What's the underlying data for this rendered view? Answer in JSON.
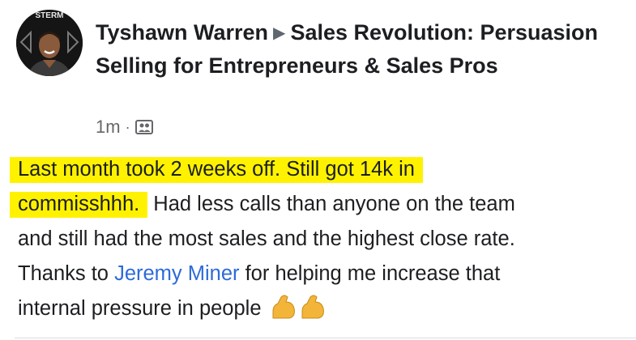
{
  "post": {
    "author": "Tyshawn Warren",
    "group": "Sales Revolution: Persuasion Selling for Entrepreneurs & Sales Pros",
    "timestamp": "1m",
    "separator": "·",
    "audience_icon": "group-audience-icon",
    "avatar_text": "STERM"
  },
  "content": {
    "highlight_line1": "Last month took 2 weeks off. Still got 14k in",
    "highlight_line2": "commisshhh.",
    "line2_rest": " Had less calls than anyone on the team",
    "line3": "and still had the most sales and the highest close rate.",
    "line4_before": "Thanks to ",
    "mention": "Jeremy Miner",
    "line4_after": " for helping me increase that",
    "line5": "internal pressure in people",
    "emoji": "💪💪"
  },
  "colors": {
    "highlight": "#fff200",
    "mention": "#2d6bd8",
    "meta_text": "#65676b"
  }
}
